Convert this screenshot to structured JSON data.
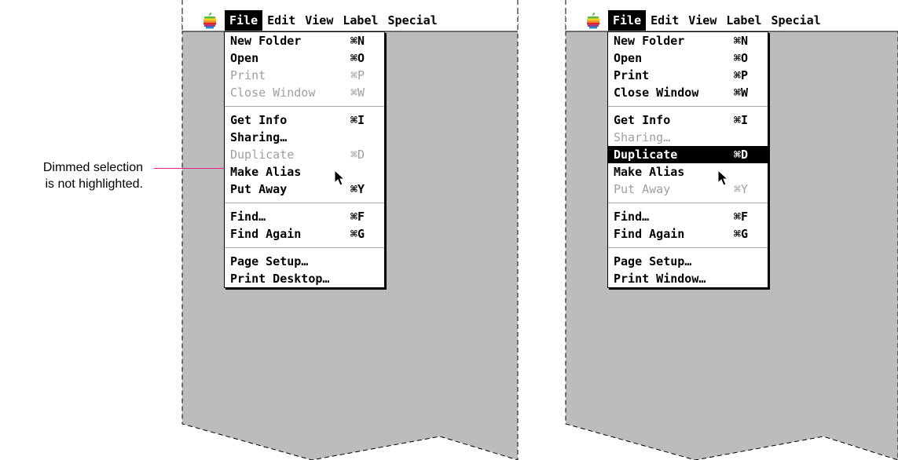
{
  "callout": {
    "text": "Dimmed selection\nis not highlighted."
  },
  "panels": [
    {
      "menubar": [
        "File",
        "Edit",
        "View",
        "Label",
        "Special"
      ],
      "items": [
        {
          "label": "New Folder",
          "shortcut": "⌘N",
          "state": "normal"
        },
        {
          "label": "Open",
          "shortcut": "⌘O",
          "state": "normal"
        },
        {
          "label": "Print",
          "shortcut": "⌘P",
          "state": "dimmed"
        },
        {
          "label": "Close Window",
          "shortcut": "⌘W",
          "state": "dimmed"
        },
        {
          "sep": true
        },
        {
          "label": "Get Info",
          "shortcut": "⌘I",
          "state": "normal"
        },
        {
          "label": "Sharing…",
          "shortcut": "",
          "state": "normal"
        },
        {
          "label": "Duplicate",
          "shortcut": "⌘D",
          "state": "dimmed"
        },
        {
          "label": "Make Alias",
          "shortcut": "",
          "state": "normal"
        },
        {
          "label": "Put Away",
          "shortcut": "⌘Y",
          "state": "normal"
        },
        {
          "sep": true
        },
        {
          "label": "Find…",
          "shortcut": "⌘F",
          "state": "normal"
        },
        {
          "label": "Find Again",
          "shortcut": "⌘G",
          "state": "normal"
        },
        {
          "sep": true
        },
        {
          "label": "Page Setup…",
          "shortcut": "",
          "state": "normal"
        },
        {
          "label": "Print Desktop…",
          "shortcut": "",
          "state": "normal"
        }
      ]
    },
    {
      "menubar": [
        "File",
        "Edit",
        "View",
        "Label",
        "Special"
      ],
      "items": [
        {
          "label": "New Folder",
          "shortcut": "⌘N",
          "state": "normal"
        },
        {
          "label": "Open",
          "shortcut": "⌘O",
          "state": "normal"
        },
        {
          "label": "Print",
          "shortcut": "⌘P",
          "state": "normal"
        },
        {
          "label": "Close Window",
          "shortcut": "⌘W",
          "state": "normal"
        },
        {
          "sep": true
        },
        {
          "label": "Get Info",
          "shortcut": "⌘I",
          "state": "normal"
        },
        {
          "label": "Sharing…",
          "shortcut": "",
          "state": "dimmed"
        },
        {
          "label": "Duplicate",
          "shortcut": "⌘D",
          "state": "highlighted"
        },
        {
          "label": "Make Alias",
          "shortcut": "",
          "state": "normal"
        },
        {
          "label": "Put Away",
          "shortcut": "⌘Y",
          "state": "dimmed"
        },
        {
          "sep": true
        },
        {
          "label": "Find…",
          "shortcut": "⌘F",
          "state": "normal"
        },
        {
          "label": "Find Again",
          "shortcut": "⌘G",
          "state": "normal"
        },
        {
          "sep": true
        },
        {
          "label": "Page Setup…",
          "shortcut": "",
          "state": "normal"
        },
        {
          "label": "Print Window…",
          "shortcut": "",
          "state": "normal"
        }
      ]
    }
  ],
  "colors": {
    "desktop": "#bcbcbc",
    "callout_line": "#e0218a",
    "dimmed_text": "#a0a0a0"
  },
  "icons": {
    "apple": "apple-logo-icon",
    "cursor": "arrow-pointer-icon"
  }
}
